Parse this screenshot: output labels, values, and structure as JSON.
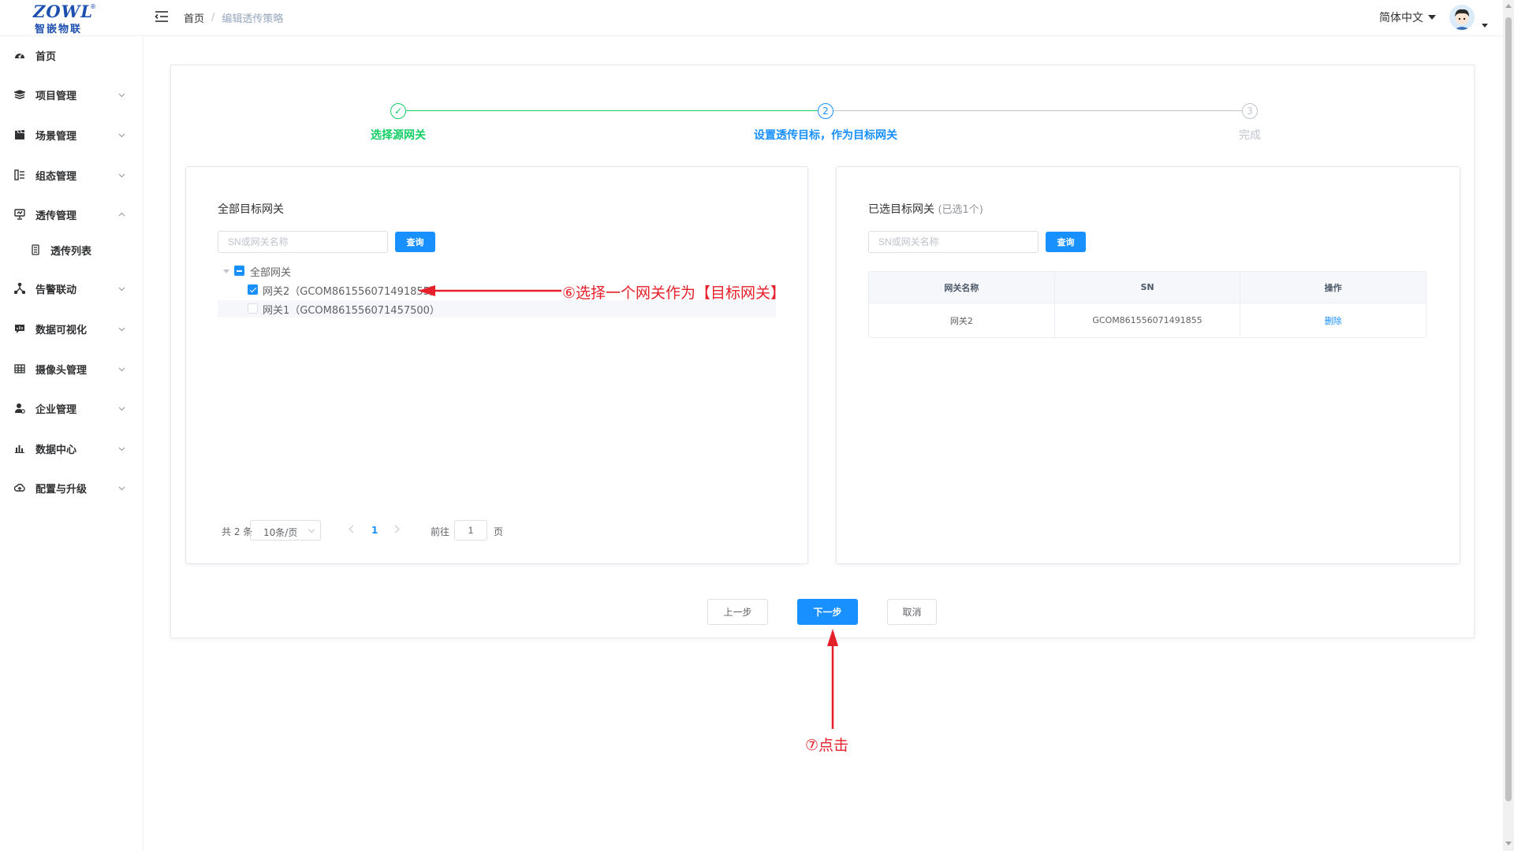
{
  "header": {
    "logo_text": "ZOWL",
    "logo_cn": "智嵌物联",
    "breadcrumb": {
      "home": "首页",
      "separator": "/",
      "current": "编辑透传策略"
    },
    "language": "简体中文"
  },
  "sidebar": {
    "items": [
      {
        "label": "首页",
        "icon": "dashboard-icon"
      },
      {
        "label": "项目管理",
        "icon": "layers-icon"
      },
      {
        "label": "场景管理",
        "icon": "clapper-icon"
      },
      {
        "label": "组态管理",
        "icon": "topology-icon"
      },
      {
        "label": "透传管理",
        "icon": "monitor-icon"
      },
      {
        "label": "透传列表",
        "icon": "list-icon"
      },
      {
        "label": "告警联动",
        "icon": "network-icon"
      },
      {
        "label": "数据可视化",
        "icon": "chat-chart-icon"
      },
      {
        "label": "摄像头管理",
        "icon": "grid-icon"
      },
      {
        "label": "企业管理",
        "icon": "user-gear-icon"
      },
      {
        "label": "数据中心",
        "icon": "bar-chart-icon"
      },
      {
        "label": "配置与升级",
        "icon": "cloud-upload-icon"
      }
    ]
  },
  "steps": [
    {
      "title": "选择源网关",
      "status": "finish",
      "marker": "✓",
      "color": "#13ce66"
    },
    {
      "title": "设置透传目标，作为目标网关",
      "status": "process",
      "marker": "2",
      "color": "#1890ff"
    },
    {
      "title": "完成",
      "status": "wait",
      "marker": "3",
      "color": "#c0c4cc"
    }
  ],
  "left_panel": {
    "title": "全部目标网关",
    "search_placeholder": "SN或网关名称",
    "search_button": "查询",
    "tree": {
      "root_label": "全部网关",
      "children": [
        {
          "label": "网关2（GCOM861556071491855）",
          "checked": true
        },
        {
          "label": "网关1（GCOM861556071457500）",
          "checked": false
        }
      ]
    },
    "pagination": {
      "total": "共 2 条",
      "page_size": "10条/页",
      "current_page": "1",
      "goto_label": "前往",
      "goto_value": "1",
      "page_unit": "页"
    }
  },
  "right_panel": {
    "title": "已选目标网关",
    "selected_count": "(已选1个)",
    "search_placeholder": "SN或网关名称",
    "search_button": "查询",
    "table": {
      "columns": [
        "网关名称",
        "SN",
        "操作"
      ],
      "rows": [
        {
          "name": "网关2",
          "sn": "GCOM861556071491855",
          "action": "删除"
        }
      ]
    }
  },
  "buttons": {
    "prev": "上一步",
    "next": "下一步",
    "cancel": "取消"
  },
  "annotations": {
    "select_hint": "⑥选择一个网关作为【目标网关】",
    "click_hint": "⑦点击"
  },
  "colors": {
    "primary": "#1890ff",
    "success": "#13ce66",
    "annotation": "#e6202a"
  }
}
